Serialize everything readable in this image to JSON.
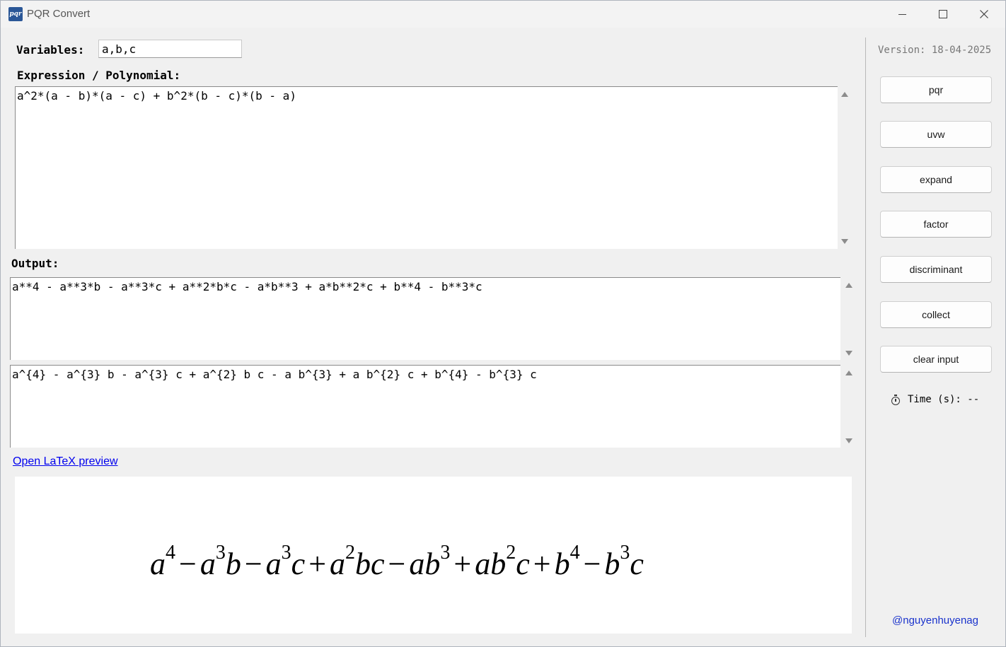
{
  "window": {
    "icon_text": "pqr",
    "title": "PQR Convert",
    "minimize_icon": "minimize-icon",
    "maximize_icon": "maximize-icon",
    "close_icon": "close-icon"
  },
  "variables": {
    "label": "Variables:",
    "value": "a,b,c"
  },
  "expression": {
    "label": "Expression / Polynomial:",
    "value": "a^2*(a - b)*(a - c) + b^2*(b - c)*(b - a)"
  },
  "output": {
    "label": "Output:",
    "python_text": "a**4 - a**3*b - a**3*c + a**2*b*c - a*b**3 + a*b**2*c + b**4 - b**3*c",
    "latex_text": "a^{4} - a^{3} b - a^{3} c + a^{2} b c - a b^{3} + a b^{2} c + b^{4} - b^{3} c"
  },
  "latex_link": "Open LaTeX preview",
  "preview": {
    "terms": [
      {
        "base": "a",
        "sup": "4"
      },
      {
        "op": "−"
      },
      {
        "base": "a",
        "sup": "3",
        "tail": "b"
      },
      {
        "op": "−"
      },
      {
        "base": "a",
        "sup": "3",
        "tail": "c"
      },
      {
        "op": "+"
      },
      {
        "base": "a",
        "sup": "2",
        "tail": "bc"
      },
      {
        "op": "−"
      },
      {
        "base": "ab",
        "sup": "3"
      },
      {
        "op": "+"
      },
      {
        "base": "ab",
        "sup": "2",
        "tail": "c"
      },
      {
        "op": "+"
      },
      {
        "base": "b",
        "sup": "4"
      },
      {
        "op": "−"
      },
      {
        "base": "b",
        "sup": "3",
        "tail": "c"
      }
    ]
  },
  "sidebar": {
    "version": "Version: 18-04-2025",
    "buttons": [
      "pqr",
      "uvw",
      "expand",
      "factor",
      "discriminant",
      "collect",
      "clear input"
    ],
    "timer_label": "Time (s): --",
    "timer_icon": "stopwatch-icon",
    "credit": "@nguyenhuyenag"
  },
  "colors": {
    "background": "#f0f0f0",
    "link": "#0000ee",
    "credit": "#1a33cc",
    "version": "#777777"
  }
}
